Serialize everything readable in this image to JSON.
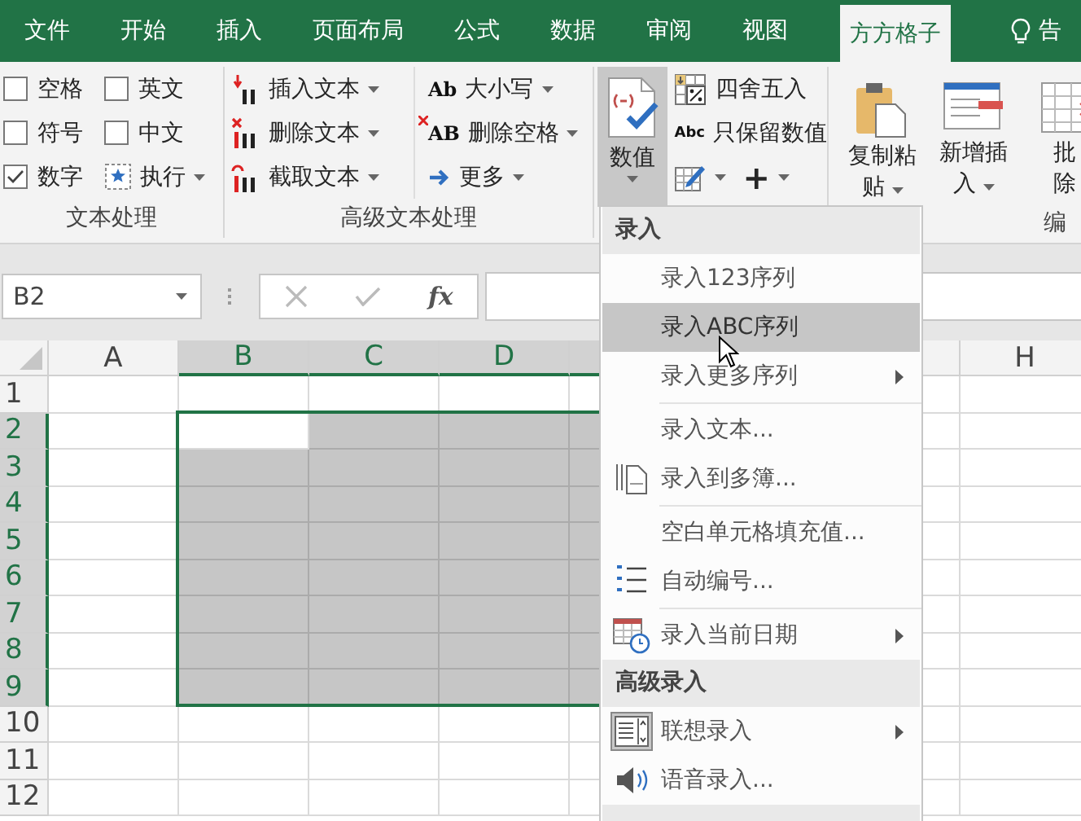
{
  "tabs": [
    {
      "label": "文件",
      "selected": false
    },
    {
      "label": "开始",
      "selected": false
    },
    {
      "label": "插入",
      "selected": false
    },
    {
      "label": "页面布局",
      "selected": false
    },
    {
      "label": "公式",
      "selected": false
    },
    {
      "label": "数据",
      "selected": false
    },
    {
      "label": "审阅",
      "selected": false
    },
    {
      "label": "视图",
      "selected": false
    },
    {
      "label": "方方格子",
      "selected": true
    }
  ],
  "tell_me": "告",
  "ribbon": {
    "text_group": {
      "checkboxes": [
        {
          "label": "空格",
          "checked": false
        },
        {
          "label": "英文",
          "checked": false
        },
        {
          "label": "符号",
          "checked": false
        },
        {
          "label": "中文",
          "checked": false
        },
        {
          "label": "数字",
          "checked": true
        }
      ],
      "run_button": "执行",
      "label": "文本处理"
    },
    "advanced_text_group": {
      "buttons": [
        {
          "label": "插入文本"
        },
        {
          "label": "删除文本"
        },
        {
          "label": "截取文本"
        },
        {
          "label": "大小写",
          "glyph": "Ab"
        },
        {
          "label": "删除空格",
          "glyph": "AB"
        },
        {
          "label": "更多"
        }
      ],
      "label": "高级文本处理"
    },
    "number_group": {
      "big_button": {
        "label": "数值",
        "expanded": true
      },
      "buttons": [
        {
          "label": "四舍五入"
        },
        {
          "label": "只保留数值",
          "glyph": "Abc"
        }
      ],
      "tools": [
        {
          "kind": "icon"
        },
        {
          "kind": "glyph",
          "glyph": "+"
        }
      ]
    },
    "edit_group": {
      "buttons": [
        {
          "lines": [
            "复制粘",
            "贴"
          ],
          "dropdown": true
        },
        {
          "lines": [
            "新增插",
            "入"
          ],
          "dropdown": true
        },
        {
          "lines": [
            "批",
            "除"
          ],
          "dropdown": false
        }
      ],
      "label": "编"
    }
  },
  "formula_bar": {
    "name_box": "B2",
    "function_glyph": "fx"
  },
  "sheet": {
    "columns": [
      {
        "label": "A",
        "selected": false
      },
      {
        "label": "B",
        "selected": true
      },
      {
        "label": "C",
        "selected": true
      },
      {
        "label": "D",
        "selected": true
      },
      {
        "selected": true
      },
      {
        "selected": false
      },
      {
        "label": "H",
        "selected": false
      }
    ],
    "rows": [
      {
        "label": "1",
        "selected": false
      },
      {
        "label": "2",
        "selected": true
      },
      {
        "label": "3",
        "selected": true
      },
      {
        "label": "4",
        "selected": true
      },
      {
        "label": "5",
        "selected": true
      },
      {
        "label": "6",
        "selected": true
      },
      {
        "label": "7",
        "selected": true
      },
      {
        "label": "8",
        "selected": true
      },
      {
        "label": "9",
        "selected": true
      },
      {
        "label": "10",
        "selected": false
      },
      {
        "label": "11",
        "selected": false
      },
      {
        "label": "12",
        "selected": false
      }
    ]
  },
  "menu": {
    "items": [
      {
        "kind": "header",
        "label": "录入"
      },
      {
        "kind": "item",
        "label": "录入123序列",
        "selected": false,
        "submenu": false
      },
      {
        "kind": "item",
        "label": "录入ABC序列",
        "selected": true,
        "submenu": false
      },
      {
        "kind": "item",
        "label": "录入更多序列",
        "selected": false,
        "submenu": true
      },
      {
        "kind": "separator"
      },
      {
        "kind": "item",
        "label": "录入文本...",
        "selected": false,
        "submenu": false
      },
      {
        "kind": "item",
        "label": "录入到多簿...",
        "selected": false,
        "submenu": false
      },
      {
        "kind": "separator"
      },
      {
        "kind": "item",
        "label": "空白单元格填充值...",
        "selected": false,
        "submenu": false
      },
      {
        "kind": "item",
        "label": "自动编号...",
        "selected": false,
        "submenu": false
      },
      {
        "kind": "separator"
      },
      {
        "kind": "item",
        "label": "录入当前日期",
        "selected": false,
        "submenu": true
      },
      {
        "kind": "header",
        "label": "高级录入"
      },
      {
        "kind": "item",
        "label": "联想录入",
        "selected": false,
        "submenu": true
      },
      {
        "kind": "item",
        "label": "语音录入...",
        "selected": false,
        "submenu": false
      },
      {
        "kind": "header"
      }
    ]
  }
}
